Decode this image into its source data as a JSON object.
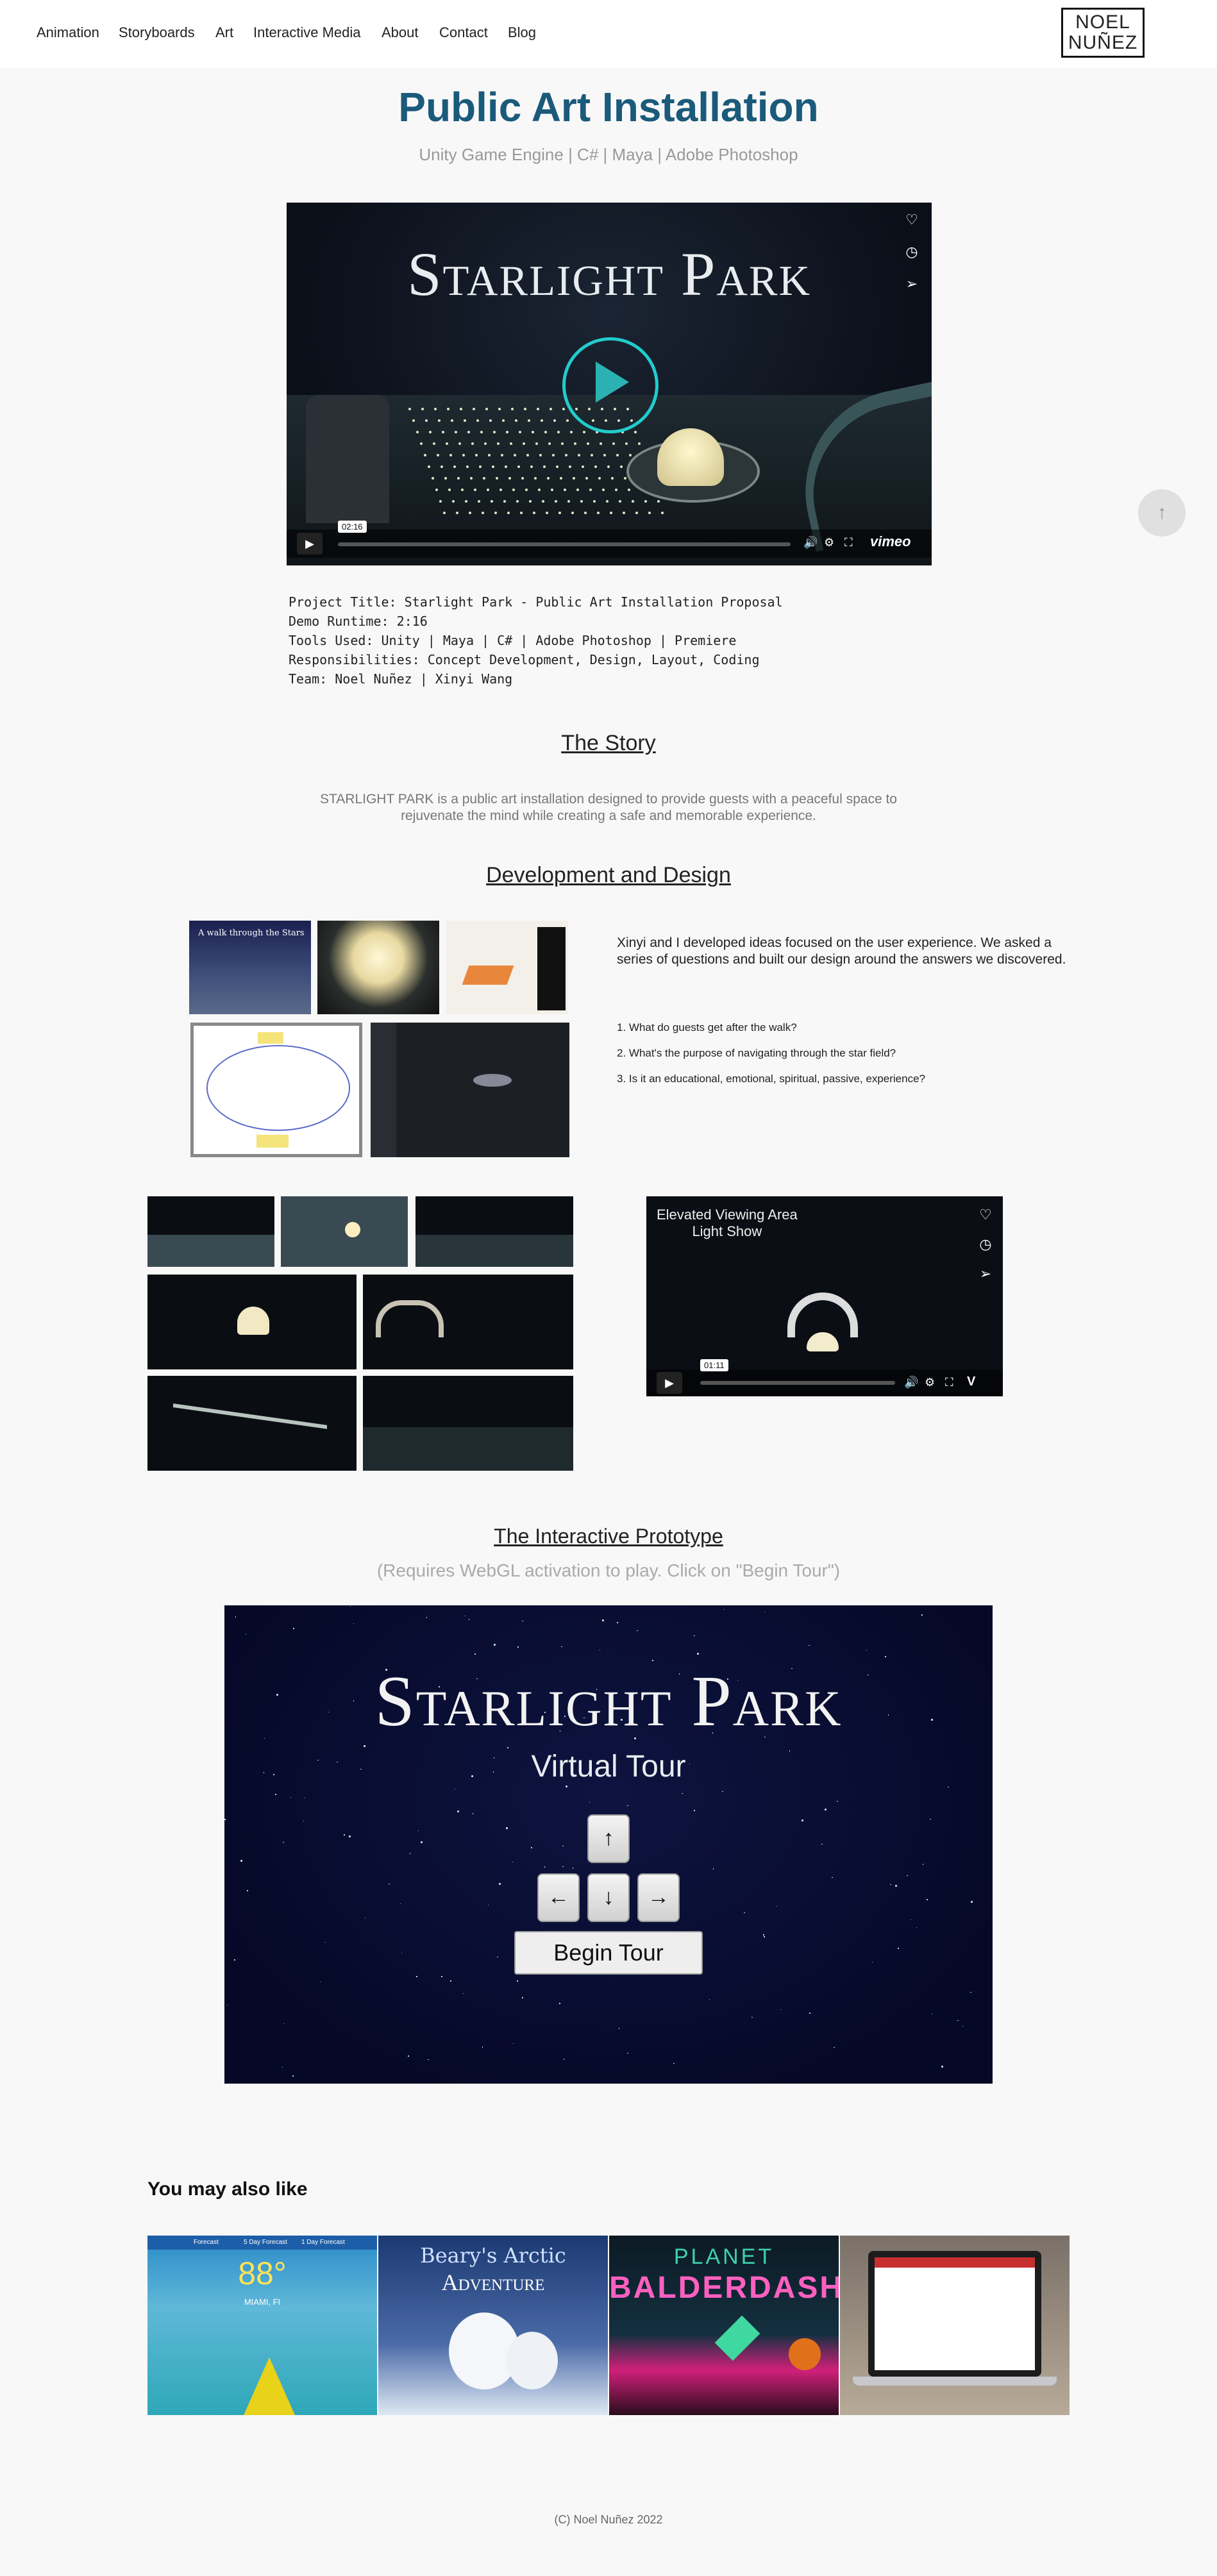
{
  "nav": {
    "items": [
      "Animation",
      "Storyboards",
      "Art",
      "Interactive Media",
      "About",
      "Contact",
      "Blog"
    ],
    "logo_line1": "NOEL",
    "logo_line2": "NUÑEZ"
  },
  "header": {
    "title": "Public Art Installation",
    "subtitle": "Unity Game Engine | C# | Maya | Adobe Photoshop"
  },
  "video_main": {
    "title": "Starlight Park",
    "time": "02:16",
    "brand": "vimeo"
  },
  "project_info": [
    "Project Title: Starlight Park - Public Art Installation Proposal",
    "Demo Runtime: 2:16",
    "Tools Used: Unity | Maya | C# | Adobe Photoshop | Premiere",
    "Responsibilities: Concept Development, Design, Layout, Coding",
    "Team: Noel Nuñez | Xinyi Wang"
  ],
  "story": {
    "heading": "The Story",
    "text": "STARLIGHT PARK is a public art installation designed to provide guests with a peaceful space to rejuvenate the mind while creating a safe and memorable experience."
  },
  "development": {
    "heading": "Development and Design",
    "sketch_caption": "A walk through the Stars",
    "text": "Xinyi and I developed ideas focused on the user experience. We asked a series of questions and built our design around the answers we discovered.",
    "questions": [
      "1. What do guests get after the walk?",
      "2. What's the purpose of navigating through the star field?",
      "3. Is it an educational, emotional, spiritual, passive, experience?"
    ]
  },
  "video_small": {
    "title_line1": "Elevated Viewing Area",
    "title_line2": "Light Show",
    "time": "01:11"
  },
  "prototype": {
    "heading": "The Interactive Prototype",
    "note": "(Requires WebGL activation to play.  Click on \"Begin Tour\")",
    "title": "Starlight Park",
    "subtitle": "Virtual Tour",
    "keys": [
      "↑",
      "←",
      "↓",
      "→"
    ],
    "button": "Begin Tour"
  },
  "also_like": {
    "heading": "You may also like",
    "cards": [
      {
        "name": "weather",
        "temp": "88°",
        "city": "MIAMI, FI",
        "tabs": [
          "Forecast",
          "5 Day Forecast",
          "1 Day Forecast"
        ]
      },
      {
        "name": "arctic",
        "line1": "Beary's Arctic",
        "line2": "Adventure"
      },
      {
        "name": "planet",
        "line1": "PLANET",
        "line2": "BALDERDASH"
      },
      {
        "name": "laptop"
      }
    ]
  },
  "footer": {
    "text": "(C) Noel Nuñez 2022"
  },
  "colors": {
    "title": "#1a5a7a",
    "accent": "#2ab2b2",
    "page_bg": "#f8f8f8"
  }
}
